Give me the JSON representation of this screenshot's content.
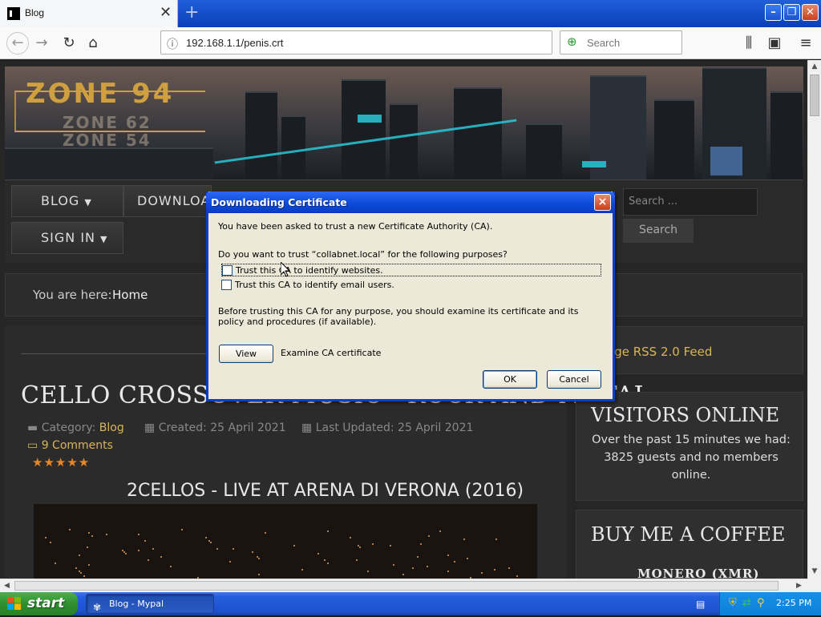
{
  "browser": {
    "tab_title": "Blog",
    "new_tab_symbol": "+",
    "url": "192.168.1.1/penis.crt",
    "search_placeholder": "Search"
  },
  "site": {
    "logo_main": "ZONE 94",
    "logo_sub1": "ZONE 62",
    "logo_sub2": "ZONE 54",
    "menu": {
      "blog": "BLOG",
      "download": "DOWNLOA",
      "signin": "SIGN IN"
    },
    "search_placeholder": "Search ...",
    "search_button": "Search",
    "breadcrumb_label": "You are here:",
    "breadcrumb_home": "Home"
  },
  "article": {
    "title": "CELLO CROSSOVER MUSIC - ROCK AND METAL",
    "category_label": "Category:",
    "category": "Blog",
    "created": "Created: 25 April 2021",
    "updated": "Last Updated: 25 April 2021",
    "comments": "9 Comments",
    "rating_stars": 5,
    "video_title": "2CELLOS - LIVE AT ARENA DI VERONA (2016)"
  },
  "sidebar": {
    "rss": "age RSS 2.0 Feed",
    "visitors_title": "VISITORS ONLINE",
    "visitors_text": "Over the past 15 minutes we had: 3825 guests and no members online.",
    "coffee_title": "BUY ME A COFFEE",
    "coffee_sub": "MONERO (XMR)"
  },
  "dialog": {
    "title": "Downloading Certificate",
    "close_symbol": "×",
    "msg1": "You have been asked to trust a new Certificate Authority (CA).",
    "msg2": "Do you want to trust “collabnet.local” for the following purposes?",
    "check_web": "Trust this CA to identify websites.",
    "check_web_checked": false,
    "check_email": "Trust this CA to identify email users.",
    "check_email_checked": false,
    "msg3": "Before trusting this CA for any purpose, you should examine its certificate and its policy and procedures (if available).",
    "view_button": "View",
    "view_desc": "Examine CA certificate",
    "ok_button": "OK",
    "cancel_button": "Cancel"
  },
  "taskbar": {
    "start": "start",
    "task_item": "Blog - Mypal",
    "clock": "2:25 PM"
  },
  "colors": {
    "accent_link": "#d7b55a",
    "star": "#e6862a",
    "xp_blue": "#245edb",
    "xp_start_green": "#2f8e2f"
  }
}
